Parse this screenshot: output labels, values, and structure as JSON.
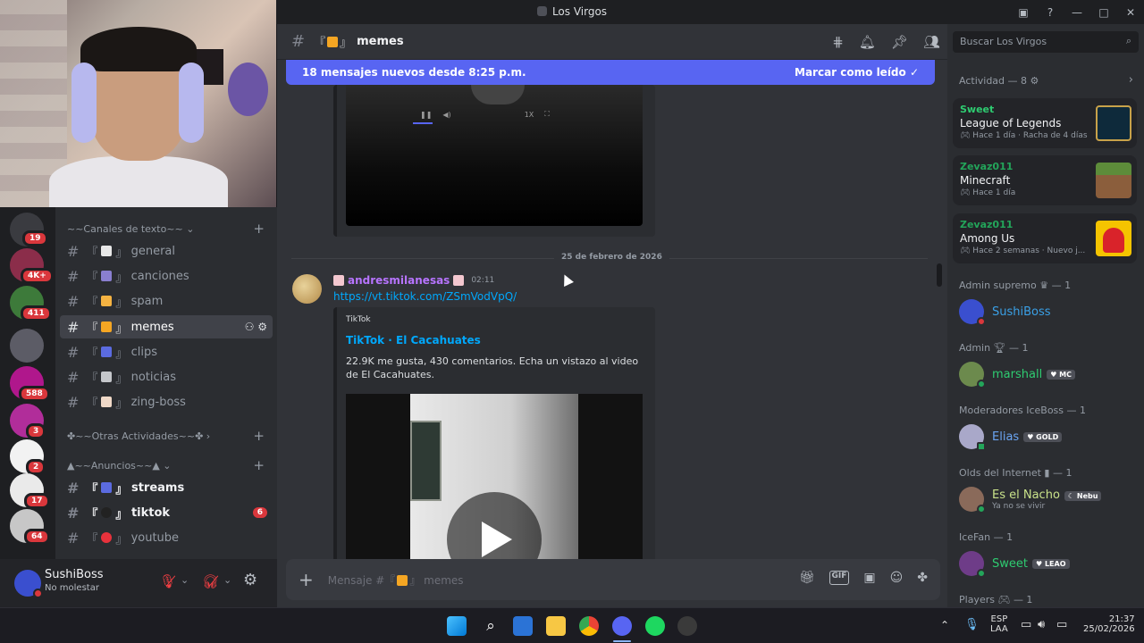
{
  "window": {
    "title": "Los Virgos"
  },
  "webcam": {
    "label": "webcam overlay"
  },
  "servers": [
    {
      "badge": "19",
      "color": "#3a3b40"
    },
    {
      "badge": "4K+",
      "color": "#8b2d4a"
    },
    {
      "badge": "411",
      "color": "#3d7a3a"
    },
    {
      "badge": "",
      "color": "#5c5c66"
    },
    {
      "badge": "588",
      "color": "#b0178c"
    },
    {
      "badge": "3",
      "color": "#b12d9a"
    },
    {
      "badge": "2",
      "color": "#f2f2f2"
    },
    {
      "badge": "17",
      "color": "#eaeaea"
    },
    {
      "badge": "64",
      "color": "#c7c7c7"
    }
  ],
  "channels": {
    "category_text": "~~Canales de texto~~",
    "items_text": [
      {
        "label": "general",
        "bracket": "『",
        "close": "』"
      },
      {
        "label": "canciones",
        "bracket": "『",
        "close": "』"
      },
      {
        "label": "spam",
        "bracket": "『",
        "close": "』"
      },
      {
        "label": "memes",
        "bracket": "『",
        "close": "』"
      },
      {
        "label": "clips",
        "bracket": "『",
        "close": "』"
      },
      {
        "label": "noticias",
        "bracket": "『",
        "close": "』"
      },
      {
        "label": "zing-boss",
        "bracket": "『",
        "close": "』"
      }
    ],
    "category_other": "~~Otras Actividades~~",
    "category_announce": "~~Anuncios~~",
    "items_announce": [
      {
        "label": "streams",
        "bracket": "『",
        "close": "』",
        "count": ""
      },
      {
        "label": "tiktok",
        "bracket": "『",
        "close": "』",
        "count": "6"
      },
      {
        "label": "youtube",
        "bracket": "『",
        "close": "』",
        "count": ""
      }
    ]
  },
  "user_panel": {
    "name": "SushiBoss",
    "status": "No molestar"
  },
  "chat": {
    "channel_name": "memes",
    "channel_prefix": "『",
    "channel_suffix": "』",
    "banner_text": "18 mensajes nuevos desde 8:25 p.m.",
    "banner_action": "Marcar como leído",
    "video_controls": {
      "speed": "1X"
    },
    "date_divider": "25 de febrero de 2026",
    "message": {
      "author": "andresmilanesas",
      "time": "02:11",
      "link": "https://vt.tiktok.com/ZSmVodVpQ/",
      "embed_provider": "TikTok",
      "embed_title": "TikTok · El Cacahuates",
      "embed_desc": "22.9K me gusta, 430 comentarios. Echa un vistazo al video de El Cacahuates."
    },
    "input_placeholder": "Mensaje #『",
    "input_placeholder_channel": "』 memes"
  },
  "members": {
    "search_placeholder": "Buscar Los Virgos",
    "activity_header": "Actividad — 8",
    "activities": [
      {
        "who": "Sweet",
        "game": "League of Legends",
        "meta1": "Hace 1 día",
        "meta2": "Racha de 4 días",
        "art_color": "#0e2a3b"
      },
      {
        "who": "Zevaz011",
        "game": "Minecraft",
        "meta1": "Hace 1 día",
        "meta2": "",
        "art_color": "#5d8c3a"
      },
      {
        "who": "Zevaz011",
        "game": "Among Us",
        "meta1": "Hace 2 semanas",
        "meta2": "Nuevo j...",
        "art_color": "#f5c400"
      }
    ],
    "groups": [
      {
        "role": "Admin supremo",
        "count": "— 1",
        "name": "SushiBoss",
        "name_color": "#3aa0e6",
        "tag": "",
        "sub": "",
        "av_color": "#3a4fcf",
        "status_color": "#da373c"
      },
      {
        "role": "Admin",
        "count": "— 1",
        "name": "marshall",
        "name_color": "#2ecc71",
        "tag": "MC",
        "sub": "",
        "av_color": "#6c8a4d",
        "status_color": "#23a55a"
      },
      {
        "role": "Moderadores IceBoss",
        "count": "— 1",
        "name": "Elias",
        "name_color": "#6aa4f2",
        "tag": "GOLD",
        "sub": "",
        "av_color": "#a9a8c9",
        "status_color": "#23a55a"
      },
      {
        "role": "Olds del Internet",
        "count": "— 1",
        "name": "Es el Nacho",
        "name_color": "#c9e28a",
        "tag": "Nebu",
        "sub": "Ya no se vivir",
        "av_color": "#8a6a5a",
        "status_color": "#23a55a"
      },
      {
        "role": "IceFan",
        "count": "— 1",
        "name": "Sweet",
        "name_color": "#2ecc71",
        "tag": "LEAO",
        "sub": "",
        "av_color": "#6e3c88",
        "status_color": "#23a55a"
      }
    ],
    "players_header": "Players",
    "players_count": "— 1"
  },
  "taskbar": {
    "lang1": "ESP",
    "lang2": "LAA",
    "time": "21:37",
    "date": "25/02/2026"
  }
}
